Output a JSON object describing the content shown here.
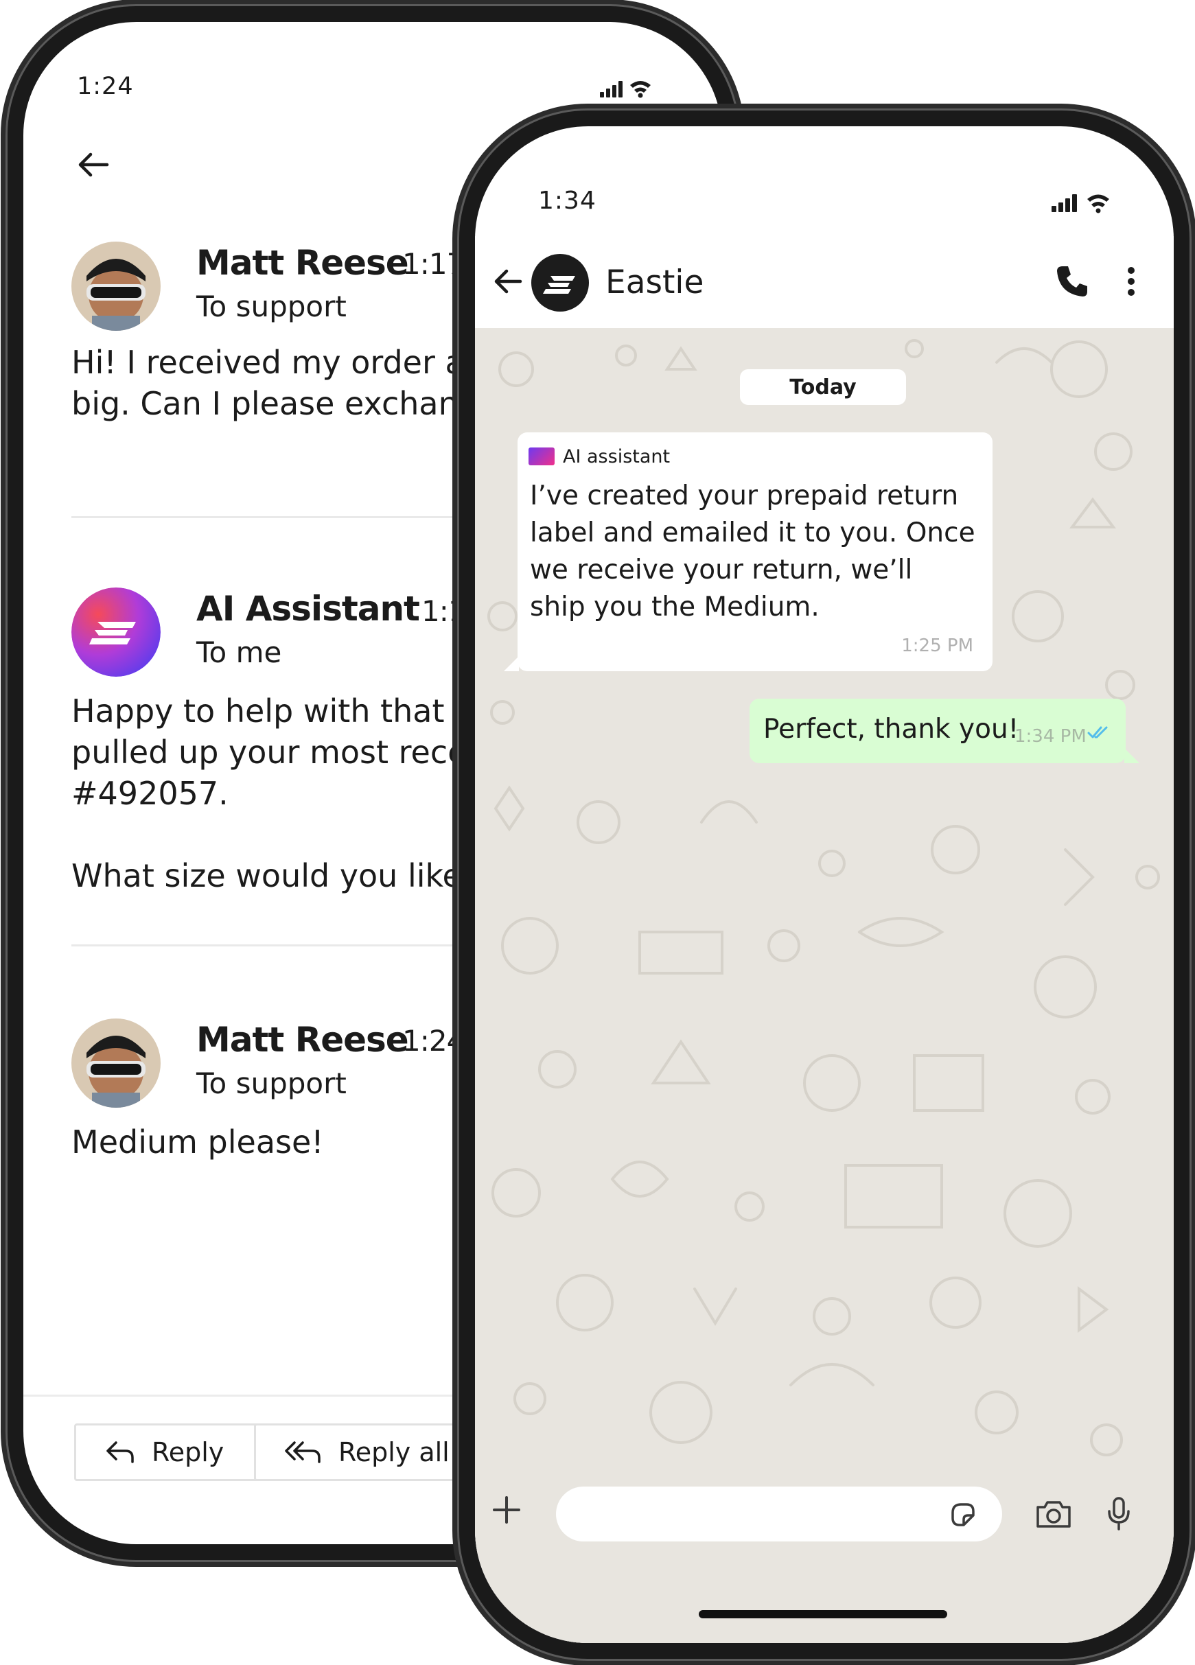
{
  "email": {
    "status_time": "1:24",
    "messages": [
      {
        "sender": "Matt Reese",
        "time": "1:17 PM",
        "recipient": "To support",
        "body": "Hi! I received my order and it's a little big. Can I please exchange it?"
      },
      {
        "sender": "AI Assistant",
        "time": "1:19 PM",
        "recipient": "To me",
        "body": "Happy to help with that exchange! I've pulled up your most recent order, #492057.",
        "body2": "What size would you like instead?"
      },
      {
        "sender": "Matt Reese",
        "time": "1:24 PM",
        "recipient": "To support",
        "body": "Medium please!"
      }
    ],
    "actions": {
      "reply": "Reply",
      "reply_all": "Reply all"
    }
  },
  "chat": {
    "status_time": "1:34",
    "contact_name": "Eastie",
    "date_label": "Today",
    "incoming": {
      "label": "AI assistant",
      "text": "I’ve created your prepaid return label and emailed it to you. Once we receive your return, we’ll ship you the Medium.",
      "time": "1:25 PM"
    },
    "outgoing": {
      "text": "Perfect, thank you!",
      "time": "1:34 PM"
    },
    "input_placeholder": ""
  },
  "colors": {
    "outgoing_bubble": "#d9fdd3",
    "chat_bg": "#e8e5df",
    "tick_blue": "#53bdeb"
  }
}
